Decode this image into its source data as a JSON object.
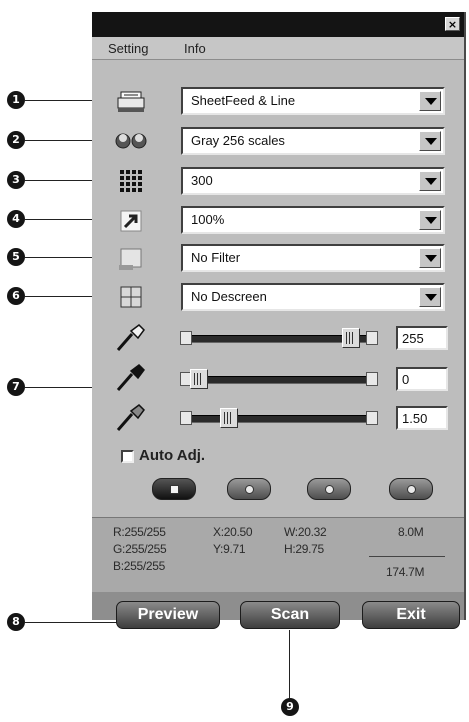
{
  "window": {
    "close_glyph": "×"
  },
  "menu": {
    "items": [
      "Setting",
      "Info"
    ]
  },
  "rows": [
    {
      "icon": "scanner-icon",
      "value": "SheetFeed & Line"
    },
    {
      "icon": "color-mode-icon",
      "value": "Gray 256 scales"
    },
    {
      "icon": "resolution-icon",
      "value": "300"
    },
    {
      "icon": "scale-icon",
      "value": "100%"
    },
    {
      "icon": "filter-icon",
      "value": "No Filter"
    },
    {
      "icon": "descreen-icon",
      "value": "No Descreen"
    }
  ],
  "adjustments": [
    {
      "icon": "white-point-eyedropper-icon",
      "value": "255",
      "level": 0.87
    },
    {
      "icon": "black-point-eyedropper-icon",
      "value": "0",
      "level": 0.05
    },
    {
      "icon": "gray-point-eyedropper-icon",
      "value": "1.50",
      "level": 0.25
    }
  ],
  "auto_adjust": {
    "label": "Auto Adj.",
    "checked": false
  },
  "mini_buttons": [
    "image-type-button",
    "preview-mode-button",
    "rotate-button",
    "options-button"
  ],
  "info": {
    "r": "R:255/255",
    "g": "G:255/255",
    "b": "B:255/255",
    "x": "X:20.50",
    "y": "Y:9.71",
    "w": "W:20.32",
    "h": "H:29.75",
    "size1": "8.0M",
    "size2": "174.7M"
  },
  "buttons": {
    "preview": "Preview",
    "scan": "Scan",
    "exit": "Exit"
  },
  "callouts": [
    "1",
    "2",
    "3",
    "4",
    "5",
    "6",
    "7",
    "8",
    "9"
  ],
  "colors": {
    "window_bg": "#bdbdbd",
    "title_bar": "#141414",
    "button_dark": "#3e3e3e"
  }
}
